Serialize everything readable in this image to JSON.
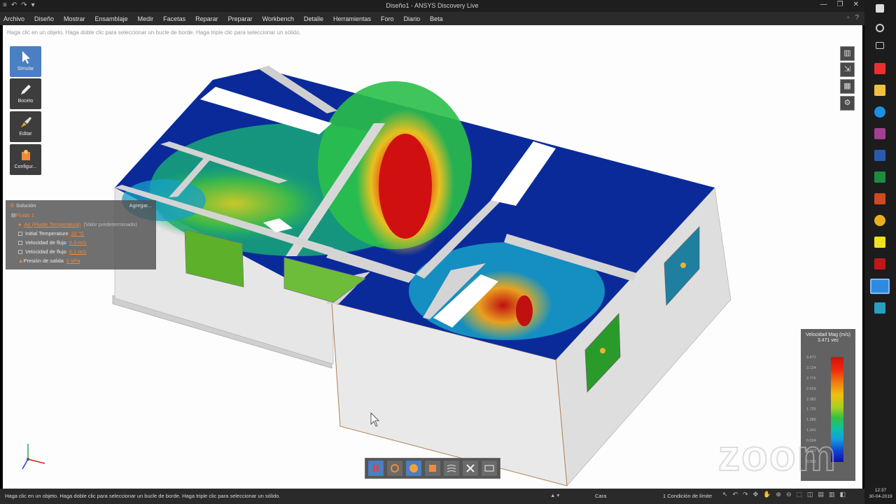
{
  "window": {
    "title": "Diseño1 - ANSYS Discovery Live",
    "quick_access": [
      "≡",
      "↶",
      "↷",
      "▾"
    ],
    "controls": [
      "—",
      "❐",
      "✕"
    ]
  },
  "menu": {
    "items": [
      "Archivo",
      "Diseño",
      "Mostrar",
      "Ensamblaje",
      "Medir",
      "Facetas",
      "Reparar",
      "Preparar",
      "Workbench",
      "Detalle",
      "Herramientas",
      "Foro",
      "Diario",
      "Beta"
    ],
    "right_icons": [
      "◦",
      "?"
    ]
  },
  "viewport": {
    "hint": "Haga clic en un objeto. Haga doble clic para seleccionar un bucle de borde. Haga triple clic para seleccionar un sólido."
  },
  "tools": [
    {
      "label": "Simular",
      "icon": "cursor-icon"
    },
    {
      "label": "Boceto",
      "icon": "pencil-icon"
    },
    {
      "label": "Editar",
      "icon": "brush-icon"
    },
    {
      "label": "Configur...",
      "icon": "config-icon"
    }
  ],
  "solution_panel": {
    "title": "Solución",
    "add_label": "Agregar...",
    "fluid": "Fluido 1",
    "air_label": "Air (Fluido Temperatura)",
    "air_suffix": "(Valor predeterminado)",
    "rows": [
      {
        "label": "Initial Temperature",
        "value": "22 °C"
      },
      {
        "label": "Velocidad de flujo",
        "value": "0.3 m/s"
      },
      {
        "label": "Velocidad de flujo",
        "value": "0.1 m/s"
      },
      {
        "label": "Presión de salida",
        "value": "0 kPa"
      }
    ]
  },
  "right_tools": [
    "▥",
    "⇲",
    "▦",
    "⚙"
  ],
  "legend": {
    "title": "Velocidad Mag (m/s)",
    "max": "3.471 vec",
    "ticks": [
      "3.471",
      "3.124",
      "2.776",
      "2.429",
      "2.082",
      "1.735",
      "1.388",
      "1.041",
      "0.694",
      "0.347",
      "0.000"
    ]
  },
  "bottom_toolbar": [
    "pause-icon",
    "rotate-icon",
    "sphere-icon",
    "cube-icon",
    "stream-icon",
    "explode-icon",
    "screen-icon"
  ],
  "watermark": "zoom",
  "status": {
    "hint": "Haga clic en un objeto. Haga doble clic para seleccionar un bucle de borde. Haga triple clic para seleccionar un sólido.",
    "dropdown": "▲ ▾",
    "face": "Cara",
    "condition": "1 Condición de límite"
  },
  "clock": {
    "time": "12:37",
    "date": "30-04-2019"
  },
  "colors": {
    "accent": "#4a7fc1",
    "highlight": "#f08a3c"
  }
}
